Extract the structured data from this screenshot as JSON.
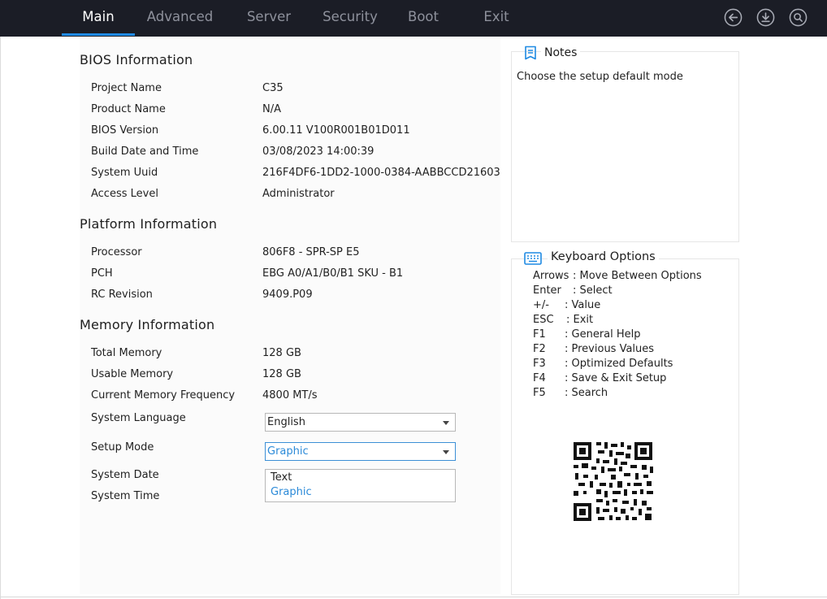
{
  "tabs": [
    {
      "label": "Main",
      "active": true
    },
    {
      "label": "Advanced",
      "active": false
    },
    {
      "label": "Server",
      "active": false
    },
    {
      "label": "Security",
      "active": false
    },
    {
      "label": "Boot",
      "active": false
    },
    {
      "label": "Exit",
      "active": false
    }
  ],
  "top_icons": [
    "back-arrow-icon",
    "download-icon",
    "search-icon"
  ],
  "colors": {
    "topbar": "#1b1d26",
    "accent": "#1f8ae3",
    "highlight_text": "#2b8ad8"
  },
  "bios": {
    "title": "BIOS Information",
    "rows": [
      {
        "label": "Project Name",
        "value": "C35"
      },
      {
        "label": "Product Name",
        "value": "N/A"
      },
      {
        "label": "BIOS Version",
        "value": "6.00.11 V100R001B01D011"
      },
      {
        "label": "Build Date and Time",
        "value": "03/08/2023 14:00:39"
      },
      {
        "label": "System Uuid",
        "value": "216F4DF6-1DD2-1000-0384-AABBCCD21603"
      },
      {
        "label": "Access Level",
        "value": "Administrator"
      }
    ]
  },
  "platform": {
    "title": "Platform Information",
    "rows": [
      {
        "label": "Processor",
        "value": "806F8 - SPR-SP E5"
      },
      {
        "label": "PCH",
        "value": "EBG A0/A1/B0/B1 SKU - B1"
      },
      {
        "label": "RC Revision",
        "value": "9409.P09"
      }
    ]
  },
  "memory": {
    "title": "Memory Information",
    "rows": [
      {
        "label": "Total Memory",
        "value": "128 GB"
      },
      {
        "label": "Usable Memory",
        "value": "128 GB"
      },
      {
        "label": "Current Memory Frequency",
        "value": "4800 MT/s"
      }
    ]
  },
  "settings": {
    "language": {
      "label": "System Language",
      "value": "English"
    },
    "setup_mode": {
      "label": "Setup Mode",
      "value": "Graphic",
      "options": [
        "Text",
        "Graphic"
      ],
      "selected": "Graphic"
    },
    "date_label": "System Date",
    "time_label": "System Time"
  },
  "notes": {
    "title": "Notes",
    "text": "Choose the setup default mode"
  },
  "keyboard": {
    "title": "Keyboard Options",
    "items": [
      {
        "key": "Arrows",
        "desc": ": Move Between Options"
      },
      {
        "key": "Enter",
        "desc": ": Select"
      },
      {
        "key": "+/-",
        "desc": ": Value"
      },
      {
        "key": "ESC",
        "desc": ": Exit"
      },
      {
        "key": "F1",
        "desc": ": General Help"
      },
      {
        "key": "F2",
        "desc": ": Previous Values"
      },
      {
        "key": "F3",
        "desc": ": Optimized Defaults"
      },
      {
        "key": "F4",
        "desc": ": Save & Exit Setup"
      },
      {
        "key": "F5",
        "desc": ": Search"
      }
    ]
  }
}
